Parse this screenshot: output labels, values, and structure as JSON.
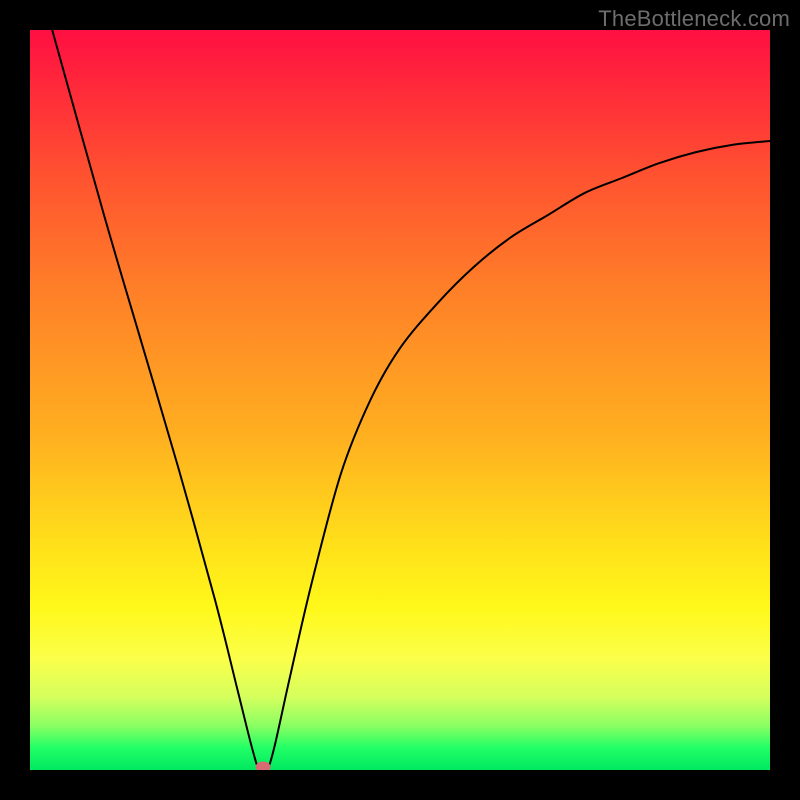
{
  "watermark": "TheBottleneck.com",
  "chart_data": {
    "type": "line",
    "title": "",
    "xlabel": "",
    "ylabel": "",
    "xlim": [
      0,
      100
    ],
    "ylim": [
      0,
      100
    ],
    "series": [
      {
        "name": "bottleneck-curve",
        "x": [
          3,
          10,
          15,
          20,
          25,
          28,
          30,
          31,
          32,
          33,
          35,
          38,
          42,
          46,
          50,
          55,
          60,
          65,
          70,
          75,
          80,
          85,
          90,
          95,
          100
        ],
        "values": [
          100,
          75,
          58,
          41,
          23,
          11,
          3,
          0,
          0,
          3,
          12,
          25,
          40,
          50,
          57,
          63,
          68,
          72,
          75,
          78,
          80,
          82,
          83.5,
          84.5,
          85
        ]
      }
    ],
    "marker": {
      "x": 31.5,
      "y": 0,
      "color": "#d86a74"
    },
    "gradient_stops": [
      {
        "pos": 0,
        "color": "#ff0f42"
      },
      {
        "pos": 50,
        "color": "#ffb020"
      },
      {
        "pos": 80,
        "color": "#fff81a"
      },
      {
        "pos": 100,
        "color": "#00e860"
      }
    ]
  }
}
